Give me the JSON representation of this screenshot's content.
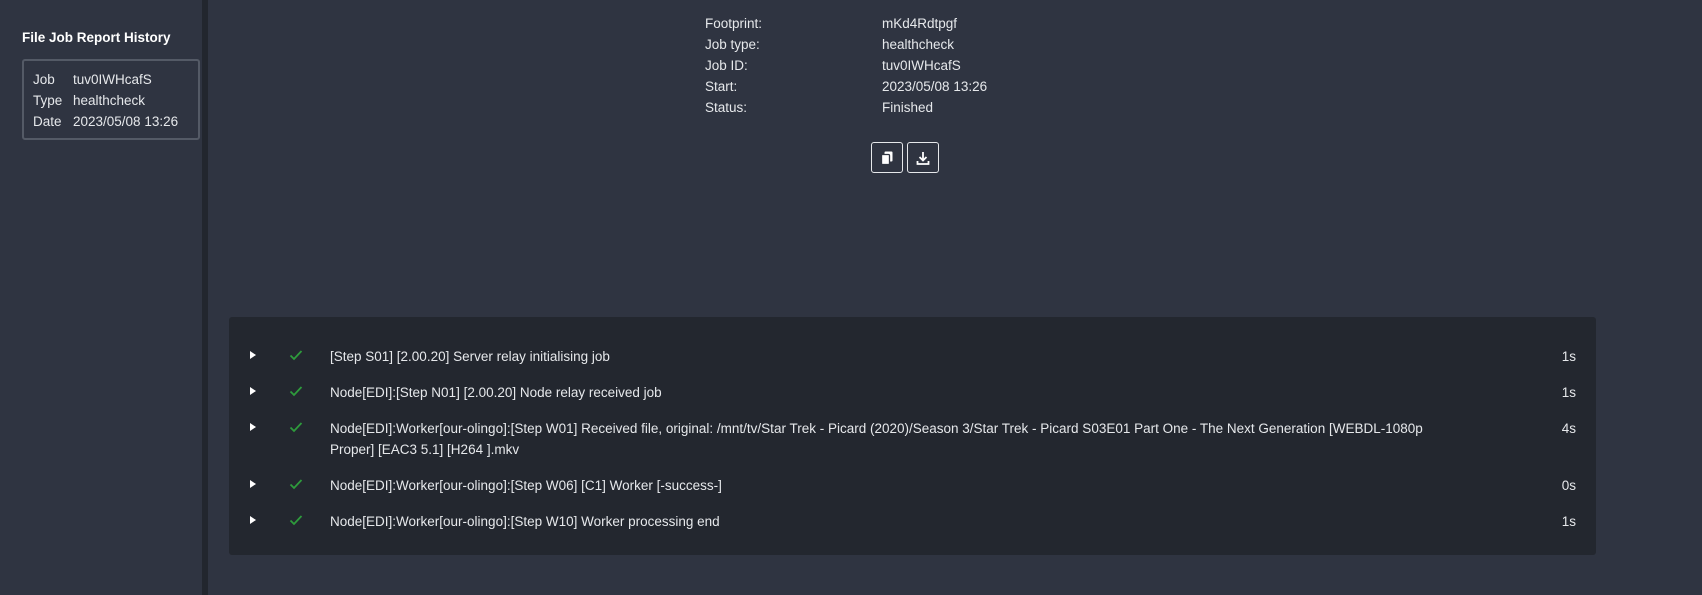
{
  "sidebar": {
    "title": "File Job Report History",
    "history": [
      {
        "job_key": "Job",
        "job_val": "tuv0IWHcafS",
        "type_key": "Type",
        "type_val": "healthcheck",
        "date_key": "Date",
        "date_val": "2023/05/08 13:26"
      }
    ]
  },
  "info": [
    {
      "key": "Footprint:",
      "value": "mKd4Rdtpgf"
    },
    {
      "key": "Job type:",
      "value": "healthcheck"
    },
    {
      "key": "Job ID:",
      "value": "tuv0IWHcafS"
    },
    {
      "key": "Start:",
      "value": "2023/05/08 13:26"
    },
    {
      "key": "Status:",
      "value": "Finished"
    }
  ],
  "actions": {
    "copy_icon": "copy-icon",
    "download_icon": "download-icon"
  },
  "log": [
    {
      "text": "[Step S01] [2.00.20] Server relay initialising job",
      "duration": "1s",
      "status": "success"
    },
    {
      "text": "Node[EDI]:[Step N01] [2.00.20] Node relay received job",
      "duration": "1s",
      "status": "success"
    },
    {
      "text": "Node[EDI]:Worker[our-olingo]:[Step W01] Received file, original: /mnt/tv/Star Trek - Picard (2020)/Season 3/Star Trek - Picard S03E01 Part One - The Next Generation [WEBDL-1080p Proper] [EAC3 5.1] [H264 ].mkv",
      "duration": "4s",
      "status": "success"
    },
    {
      "text": "Node[EDI]:Worker[our-olingo]:[Step W06] [C1] Worker [-success-]",
      "duration": "0s",
      "status": "success"
    },
    {
      "text": "Node[EDI]:Worker[our-olingo]:[Step W10] Worker processing end",
      "duration": "1s",
      "status": "success"
    }
  ],
  "colors": {
    "background": "#2f3441",
    "panel": "#23272f",
    "success": "#2e9b3c"
  }
}
